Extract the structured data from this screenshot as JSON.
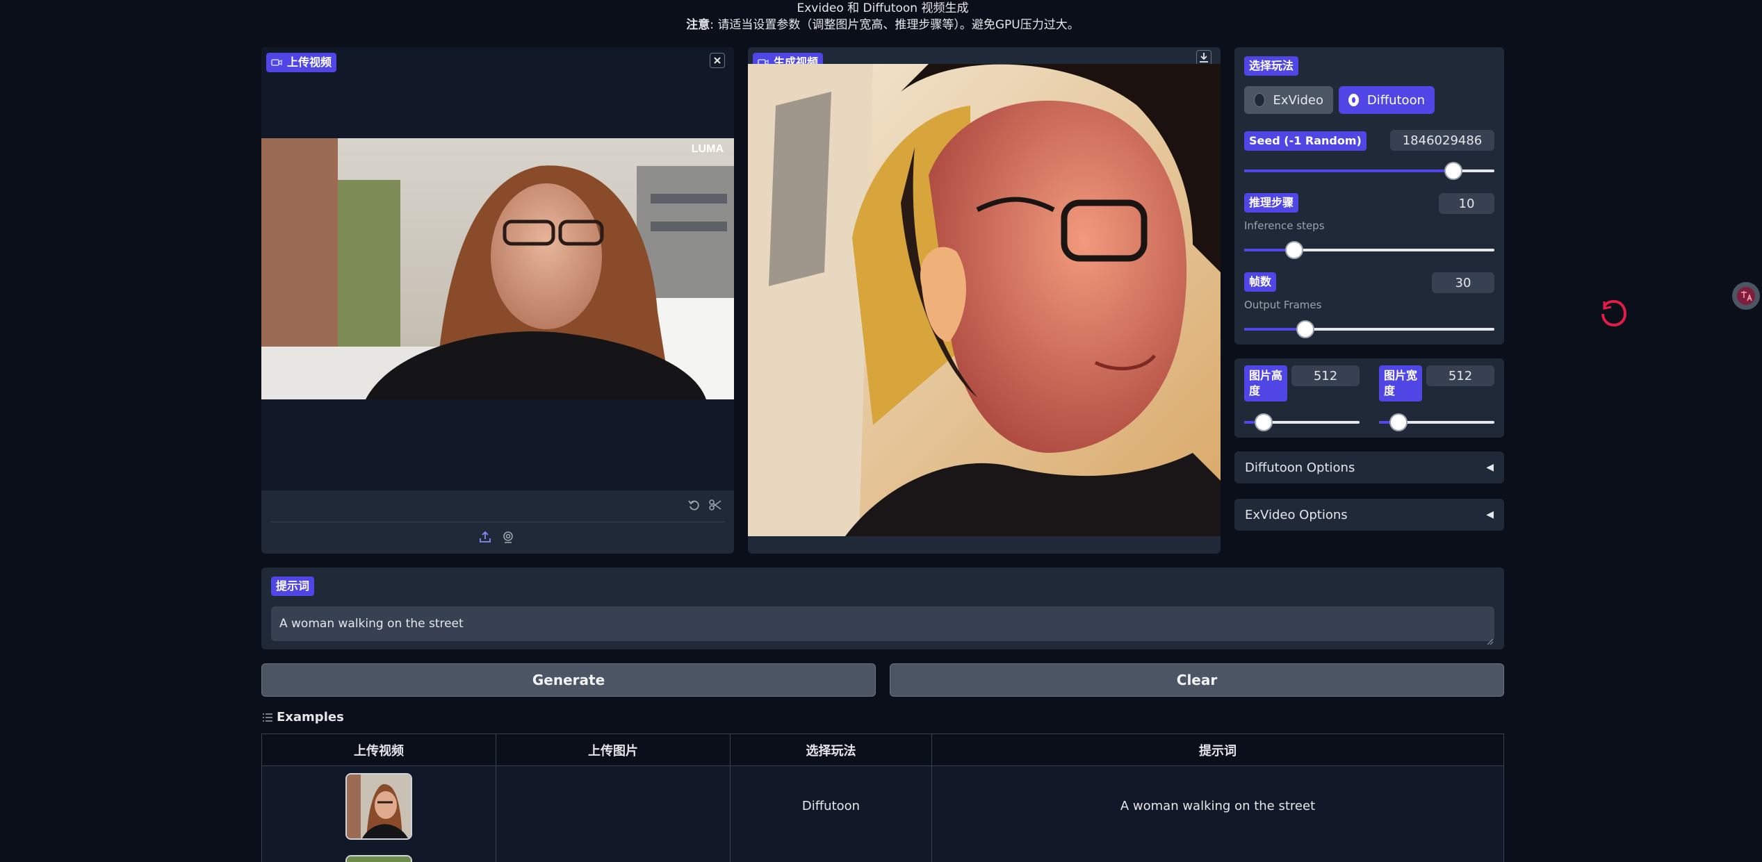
{
  "header": {
    "title": "Exvideo 和 Diffutoon 视频生成",
    "note_label": "注意",
    "note_text": ": 请适当设置参数（调整图片宽高、推理步骤等）。避免GPU压力过大。"
  },
  "upload_video": {
    "label": "上传视频",
    "watermark": "LUMA"
  },
  "output_video": {
    "label": "生成视频"
  },
  "mode": {
    "label": "选择玩法",
    "options": [
      "ExVideo",
      "Diffutoon"
    ],
    "selected": "Diffutoon"
  },
  "seed": {
    "label": "Seed (-1 Random)",
    "value": "1846029486",
    "slider_fraction": 0.835
  },
  "steps": {
    "label": "推理步骤",
    "sublabel": "Inference steps",
    "value": "10",
    "slider_fraction": 0.2
  },
  "frames": {
    "label": "帧数",
    "sublabel": "Output Frames",
    "value": "30",
    "slider_fraction": 0.245
  },
  "height": {
    "label_line1": "图片高",
    "label_line2": "度",
    "value": "512",
    "slider_fraction": 0.17
  },
  "width": {
    "label_line1": "图片宽",
    "label_line2": "度",
    "value": "512",
    "slider_fraction": 0.17
  },
  "accordions": {
    "diffutoon": "Diffutoon Options",
    "exvideo": "ExVideo Options",
    "arrow": "◀"
  },
  "prompt": {
    "label": "提示词",
    "value": "A woman walking on the street"
  },
  "buttons": {
    "generate": "Generate",
    "clear": "Clear"
  },
  "examples": {
    "title": "Examples",
    "columns": [
      "上传视频",
      "上传图片",
      "选择玩法",
      "提示词"
    ],
    "rows": [
      {
        "mode": "Diffutoon",
        "prompt": "A woman walking on the street"
      }
    ]
  },
  "colors": {
    "accent": "#4f46e5",
    "background": "#0b0f19",
    "panel": "#1f2937"
  }
}
